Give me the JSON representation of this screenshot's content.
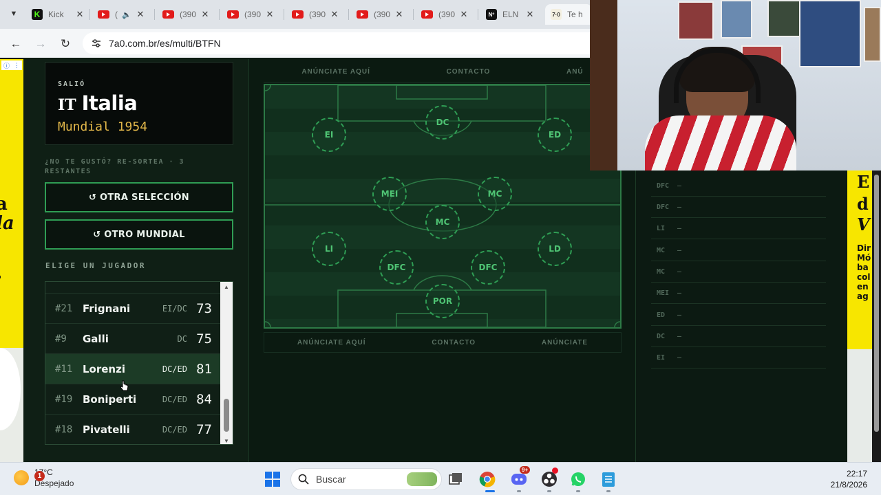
{
  "browser": {
    "tabs": [
      {
        "title": "Kick",
        "icon": "kick-icon"
      },
      {
        "title": "(",
        "icon": "youtube-icon",
        "audio": true
      },
      {
        "title": "(390",
        "icon": "youtube-icon"
      },
      {
        "title": "(390",
        "icon": "youtube-icon"
      },
      {
        "title": "(390",
        "icon": "youtube-icon"
      },
      {
        "title": "(390",
        "icon": "youtube-icon"
      },
      {
        "title": "(390",
        "icon": "youtube-icon"
      },
      {
        "title": "ELN",
        "icon": "eln-icon"
      },
      {
        "title": "Te h",
        "icon": "site-icon",
        "active": true
      }
    ],
    "kick_glyph": "K",
    "eln_glyph": "Nº",
    "site_glyph": "7·0",
    "url": "7a0.com.br/es/multi/BTFN"
  },
  "result": {
    "label": "SALIÓ",
    "team_code": "IT",
    "team_name": "Italia",
    "world_cup": "Mundial 1954"
  },
  "retry_text": "¿NO TE GUSTÓ? RE-SORTEA · 3 RESTANTES",
  "buttons": {
    "other_selection": "↺ OTRA SELECCIÓN",
    "other_worldcup": "↺ OTRO MUNDIAL"
  },
  "choose_label": "ELIGE UN JUGADOR",
  "players": [
    {
      "number": "#21",
      "name": "Frignani",
      "position": "EI/DC",
      "rating": "73",
      "highlight": false
    },
    {
      "number": "#9",
      "name": "Galli",
      "position": "DC",
      "rating": "75",
      "highlight": false
    },
    {
      "number": "#11",
      "name": "Lorenzi",
      "position": "DC/ED",
      "rating": "81",
      "highlight": true
    },
    {
      "number": "#19",
      "name": "Boniperti",
      "position": "DC/ED",
      "rating": "84",
      "highlight": false
    },
    {
      "number": "#18",
      "name": "Pivatelli",
      "position": "DC/ED",
      "rating": "77",
      "highlight": false
    }
  ],
  "adbar": {
    "left": "ANÚNCIATE AQUÍ",
    "middle": "CONTACTO",
    "right_top": "ANÚ",
    "right_bottom": "ANÚNCIATE"
  },
  "pitch_positions": {
    "dc": "DC",
    "ei": "EI",
    "ed": "ED",
    "mei": "MEI",
    "mc1": "MC",
    "mc2": "MC",
    "li": "LI",
    "ld": "LD",
    "dfc1": "DFC",
    "dfc2": "DFC",
    "por": "POR"
  },
  "lineup": [
    {
      "pos": "DFC",
      "value": "—"
    },
    {
      "pos": "DFC",
      "value": "—"
    },
    {
      "pos": "LI",
      "value": "—"
    },
    {
      "pos": "MC",
      "value": "—"
    },
    {
      "pos": "MC",
      "value": "—"
    },
    {
      "pos": "MEI",
      "value": "—"
    },
    {
      "pos": "ED",
      "value": "—"
    },
    {
      "pos": "DC",
      "value": "—"
    },
    {
      "pos": "EI",
      "value": "—"
    }
  ],
  "ad_left_text": [
    "a",
    "la",
    "o"
  ],
  "ad_right_text": [
    "E",
    "d",
    "V",
    "Dir",
    "Mó",
    "ba",
    "col",
    "en",
    "ag"
  ],
  "taskbar": {
    "temperature": "17°C",
    "weather": "Despejado",
    "weather_badge": "1",
    "search_placeholder": "Buscar",
    "discord_badge": "9+",
    "time": "22:17",
    "date": "21/8/2026"
  },
  "colors": {
    "accent_green": "#2f9d54",
    "gold": "#e3b84a",
    "ad_yellow": "#f7e600",
    "background": "#0b1a11"
  }
}
